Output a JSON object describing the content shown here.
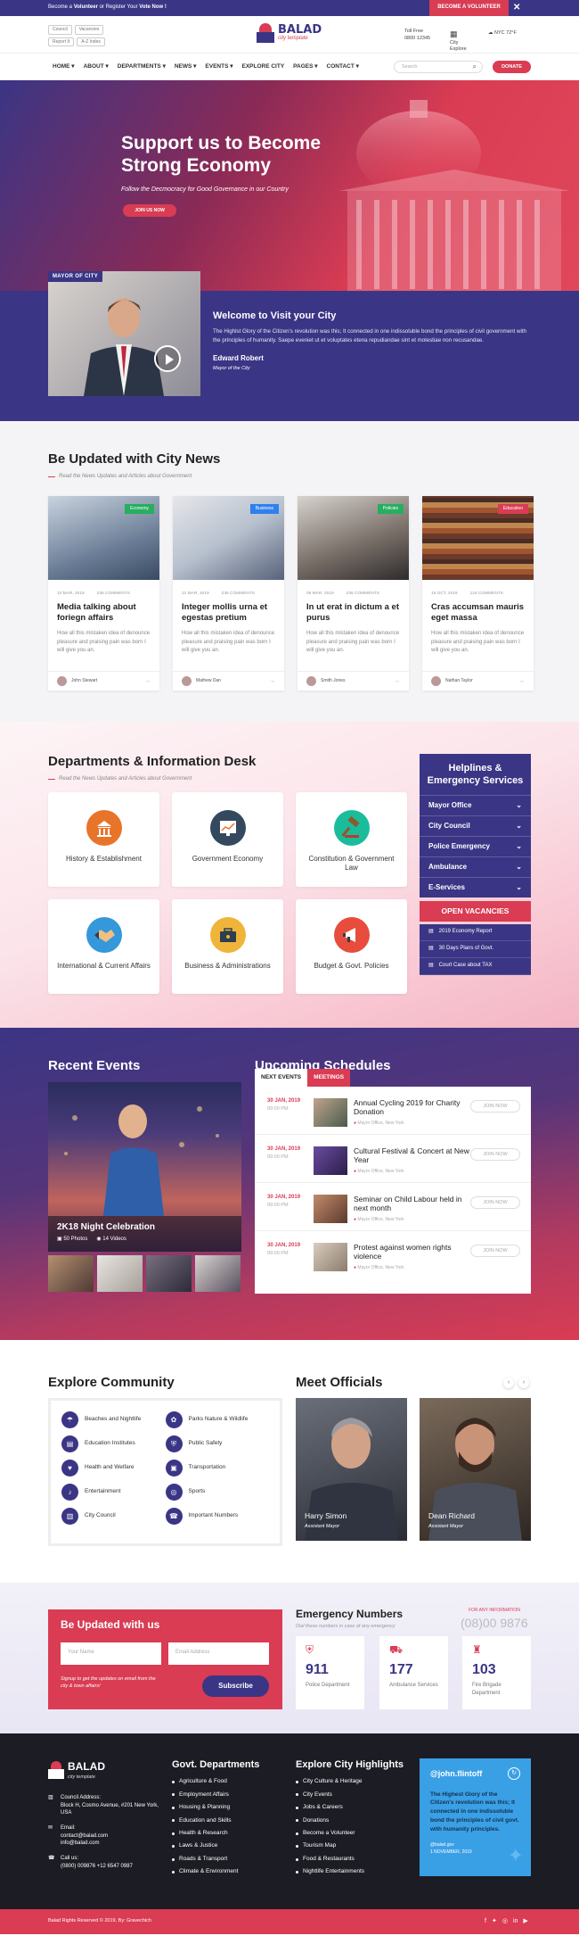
{
  "topbar": {
    "msg_pre": "Become a ",
    "msg_b1": "Volunteer",
    "msg_mid": " or Register Your ",
    "msg_b2": "Vote Now !",
    "cta": "BECOME A VOLUNTEER",
    "close": "✕"
  },
  "header": {
    "chips": [
      "Council",
      "Vacancies",
      "Report It",
      "A-Z Index"
    ],
    "logo_title": "BALAD",
    "logo_sub": "city template",
    "tollfree_label": "Toll Free",
    "tollfree_num": "0800 12345",
    "city_label": "City",
    "city_val": "Explore",
    "weather": "NYC 72°F"
  },
  "nav": {
    "items": [
      "HOME ▾",
      "ABOUT ▾",
      "DEPARTMENTS ▾",
      "NEWS ▾",
      "EVENTS ▾",
      "EXPLORE CITY",
      "PAGES ▾",
      "CONTACT ▾"
    ],
    "search_ph": "Search",
    "donate": "DONATE"
  },
  "hero": {
    "title": "Support us to Become Strong Economy",
    "sub": "Follow the Decmocracy for Good Governance in our Country",
    "join": "JOIN US NOW",
    "mayor_tag": "MAYOR OF CITY",
    "welcome_title": "Welcome to Visit your City",
    "welcome_text": "The Highlst Glory of the Citizen's revolution was this; It connected in one indissoluble bond the principles of civil government with the principles of humanity. Saepe eveniet ut et voluptates etena repudiandae sint et molestiae non recusandae.",
    "name": "Edward Robert",
    "role": "Mayor of the City"
  },
  "news": {
    "title": "Be Updated with City News",
    "sub": "Read the News Updates and Articles about Government",
    "cards": [
      {
        "badge": "Economy",
        "badge_color": "#27ae60",
        "date": "10 MAR, 2019",
        "comments": "236 COMMENTS",
        "title": "Media talking about foriegn affairs",
        "text": "How all this mistaken idea of denounce pleasure and praising pain was born I will give you an.",
        "author": "John Stewart"
      },
      {
        "badge": "Business",
        "badge_color": "#2f80ed",
        "date": "21 MAR, 2019",
        "comments": "236 COMMENTS",
        "title": "Integer mollis urna et egestas pretium",
        "text": "How all this mistaken idea of denounce pleasure and praising pain was born I will give you an.",
        "author": "Mathew Dan"
      },
      {
        "badge": "Policies",
        "badge_color": "#27ae60",
        "date": "05 MAR, 2019",
        "comments": "236 COMMENTS",
        "title": "In ut erat in dictum a et purus",
        "text": "How all this mistaken idea of denounce pleasure and praising pain was born I will give you an.",
        "author": "Smith Jones"
      },
      {
        "badge": "Education",
        "badge_color": "#d93c53",
        "date": "15 OCT, 2019",
        "comments": "124 COMMENTS",
        "title": "Cras accumsan mauris eget massa",
        "text": "How all this mistaken idea of denounce pleasure and praising pain was born I will give you an.",
        "author": "Nathan Taylor"
      }
    ]
  },
  "depts": {
    "title": "Departments & Information Desk",
    "sub": "Read the News Updates and Articles about Government",
    "items": [
      {
        "label": "History & Establishment",
        "color": "#e8742a",
        "icon": "🏛"
      },
      {
        "label": "Government Economy",
        "color": "#34495e",
        "icon": "📊"
      },
      {
        "label": "Constitution & Government Law",
        "color": "#1abc9c",
        "icon": "⚖"
      },
      {
        "label": "International & Current Affairs",
        "color": "#3498db",
        "icon": "🤝"
      },
      {
        "label": "Business & Administrations",
        "color": "#f1b43a",
        "icon": "💼"
      },
      {
        "label": "Budget & Govt. Policies",
        "color": "#e74c3c",
        "icon": "📢"
      }
    ],
    "help_title": "Helplines & Emergency Services",
    "help_items": [
      "Mayor Office",
      "City Council",
      "Police Emergency",
      "Ambulance",
      "E-Services"
    ],
    "vacancies": "OPEN VACANCIES",
    "docs": [
      "2019 Economy Report",
      "30 Days Plans of Govt.",
      "Court Case about TAX"
    ]
  },
  "events": {
    "recent": "Recent Events",
    "upcoming": "Upcoming Schedules",
    "event_title": "2K18 Night Celebration",
    "photos": "50 Photos",
    "videos": "14 Videos",
    "tab1": "NEXT EVENTS",
    "tab2": "MEETINGS",
    "rows": [
      {
        "date": "30 JAN, 2019",
        "time": "09:00 PM",
        "title": "Annual Cycling 2019 for Charity Donation",
        "loc": "Mayor Office, New York",
        "btn": "JOIN NOW"
      },
      {
        "date": "30 JAN, 2019",
        "time": "09:00 PM",
        "title": "Cultural Festival & Concert at New Year",
        "loc": "Mayor Office, New York",
        "btn": "JOIN NOW"
      },
      {
        "date": "30 JAN, 2019",
        "time": "09:00 PM",
        "title": "Seminar on Child Labour held in next month",
        "loc": "Mayor Office, New York",
        "btn": "JOIN NOW"
      },
      {
        "date": "30 JAN, 2019",
        "time": "09:00 PM",
        "title": "Protest against women rights violence",
        "loc": "Mayor Office, New York",
        "btn": "JOIN NOW"
      }
    ]
  },
  "community": {
    "title": "Explore Community",
    "items": [
      "Beaches and Nightlife",
      "Parks Nature & Wildlife",
      "Education Institutes",
      "Public Safety",
      "Health and Welfare",
      "Transportation",
      "Entertainment",
      "Sports",
      "City Council",
      "Important Numbers"
    ]
  },
  "officials": {
    "title": "Meet Officials",
    "people": [
      {
        "name": "Harry Simon",
        "role": "Assistant Mayor"
      },
      {
        "name": "Dean Richard",
        "role": "Assistant Mayor"
      }
    ]
  },
  "newsletter": {
    "title": "Be Updated with us",
    "name_ph": "Your Name",
    "email_ph": "Email Address",
    "note": "Signup to get the updates on email from the city & town affairs!",
    "btn": "Subscribe"
  },
  "emergency": {
    "title": "Emergency Numbers",
    "sub": "Dial these numbers in case of any emergency",
    "info_label": "FOR ANY INFORMATION",
    "info_num": "(08)00 9876",
    "items": [
      {
        "num": "911",
        "label": "Police Department"
      },
      {
        "num": "177",
        "label": "Ambulance Services"
      },
      {
        "num": "103",
        "label": "Fire Brigade Department"
      }
    ]
  },
  "footer": {
    "logo_title": "BALAD",
    "logo_sub": "city template",
    "addr_label": "Council Address:",
    "addr": "Block H, Cosmo Avenue, #201 New York, USA",
    "email_label": "Email:",
    "email1": "contact@balad.com",
    "email2": "info@balad.com",
    "call_label": "Call us:",
    "call": "(0800) 009876 +12 6547 0987",
    "col1_title": "Govt. Departments",
    "col1": [
      "Agriculture & Food",
      "Employment Affairs",
      "Housing & Planning",
      "Education and Skills",
      "Health & Research",
      "Laws & Justice",
      "Roads & Transport",
      "Climate & Environment"
    ],
    "col2_title": "Explore City Highlights",
    "col2": [
      "City Culture & Heritage",
      "City Events",
      "Jobs & Careers",
      "Donations",
      "Become a Volunteer",
      "Tourism Map",
      "Food & Restaurants",
      "Nightlife Entertainments"
    ],
    "tw_handle": "@john.flintoff",
    "tw_text": "The Highest Glory of the Citizen's revolution was this; It connected in one indissoluble bond the principles of civil govt. with humanity principles.",
    "tw_by": "@balad.gov",
    "tw_date": "1 NOVEMBER, 2019",
    "copy": "Balad Rights Reserved © 2019, By: Gravechich"
  }
}
